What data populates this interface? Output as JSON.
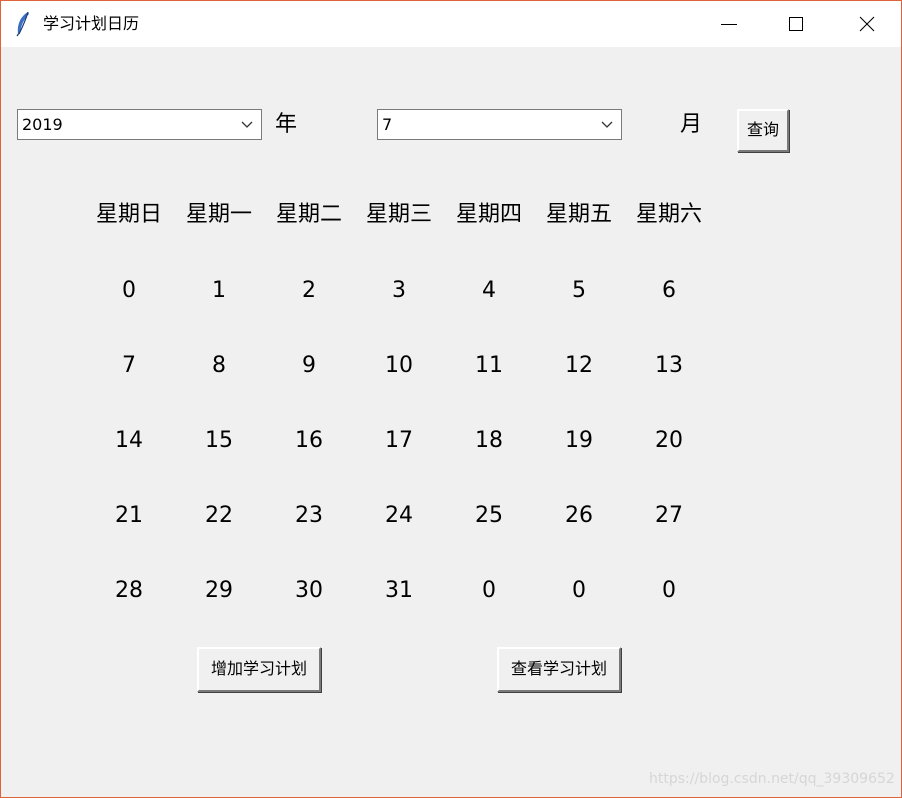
{
  "window": {
    "title": "学习计划日历",
    "icon": "feather-icon",
    "controls": [
      "minimize-icon",
      "maximize-icon",
      "close-icon"
    ]
  },
  "selector": {
    "year_value": "2019",
    "year_label": "年",
    "month_value": "7",
    "month_label": "月",
    "query_button": "查询"
  },
  "calendar": {
    "weekdays": [
      "星期日",
      "星期一",
      "星期二",
      "星期三",
      "星期四",
      "星期五",
      "星期六"
    ],
    "weeks": [
      [
        "0",
        "1",
        "2",
        "3",
        "4",
        "5",
        "6"
      ],
      [
        "7",
        "8",
        "9",
        "10",
        "11",
        "12",
        "13"
      ],
      [
        "14",
        "15",
        "16",
        "17",
        "18",
        "19",
        "20"
      ],
      [
        "21",
        "22",
        "23",
        "24",
        "25",
        "26",
        "27"
      ],
      [
        "28",
        "29",
        "30",
        "31",
        "0",
        "0",
        "0"
      ]
    ]
  },
  "actions": {
    "add_plan": "增加学习计划",
    "view_plan": "查看学习计划"
  },
  "watermark": "https://blog.csdn.net/qq_39309652",
  "colors": {
    "background": "#f0f0f0",
    "titlebar": "#ffffff",
    "window_border": "#e0623a",
    "icon_blue": "#3a6fc4"
  }
}
